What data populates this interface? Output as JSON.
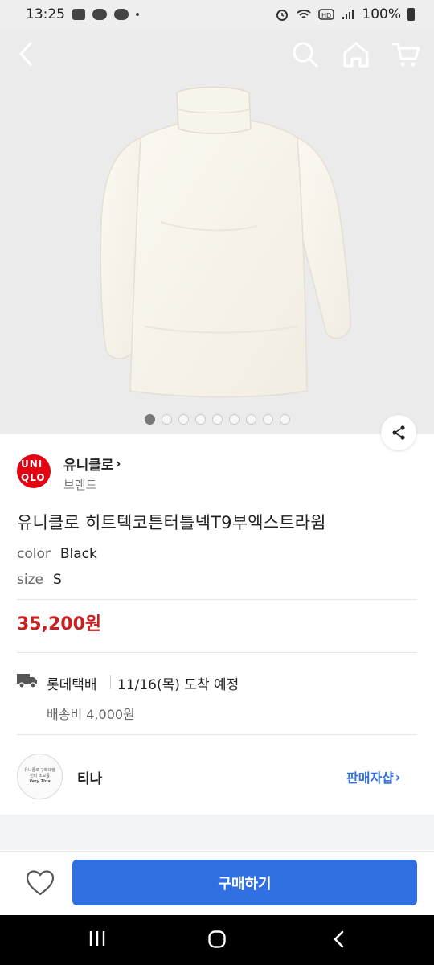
{
  "status_bar": {
    "time": "13:25",
    "battery": "100%"
  },
  "nav": {
    "icons": [
      "back-icon",
      "search-icon",
      "home-icon",
      "cart-icon"
    ]
  },
  "gallery": {
    "image_count": 9,
    "active_index": 0
  },
  "brand": {
    "logo_text": "UNI QLO",
    "name": "유니클로",
    "name_chevron": "›",
    "subtitle": "브랜드"
  },
  "product": {
    "title": "유니클로 히트텍코튼터틀넥T9부엑스트라윔",
    "color_label": "color",
    "color_value": "Black",
    "size_label": "size",
    "size_value": "S",
    "price": "35,200원"
  },
  "shipping": {
    "company": "롯데택배",
    "arrival": "11/16(목) 도착 예정",
    "fee": "배송비 4,000원"
  },
  "seller": {
    "avatar_line1": "유니클로 구매대행",
    "avatar_line2": "빈티 소모품",
    "avatar_line3": "Very Tina",
    "name": "티나",
    "shop_label": "판매자샵",
    "shop_chevron": "›"
  },
  "action": {
    "buy_label": "구매하기"
  },
  "colors": {
    "accent_blue": "#2f6fe2",
    "price_red": "#c8201f",
    "brand_red": "#e60012"
  }
}
